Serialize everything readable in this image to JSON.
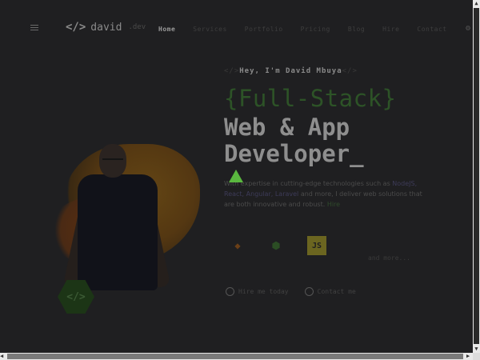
{
  "nav": {
    "logo_mark": "</>",
    "logo_text": "david",
    "logo_suffix": ".dev",
    "links": [
      "Home",
      "Services",
      "Portfolio",
      "Pricing",
      "Blog",
      "Hire",
      "Contact"
    ]
  },
  "hero": {
    "greeting_prefix": "</>",
    "greeting": "Hey, I'm David Mbuya",
    "greeting_suffix": "</>",
    "title_line1": "{Full-Stack}",
    "title_line2": "Web & App",
    "title_line3": "Developer_",
    "description_start": "With expertise in cutting-edge technologies such as",
    "description_hl1": "NodeJS, React, Angular, Laravel",
    "description_mid": "and more, I deliver web solutions that are both innovative and robust.",
    "description_hl2": "Hire",
    "badge_icon": "</>"
  },
  "skills": [
    "git-icon",
    "node-icon",
    "js-icon"
  ],
  "skill_js_label": "JS",
  "skills_more": "and more...",
  "actions": {
    "primary_label": "Hire me today",
    "secondary_label": "Contact me"
  },
  "colors": {
    "accent_green": "#5ab73f",
    "bg": "#1f1f21"
  }
}
